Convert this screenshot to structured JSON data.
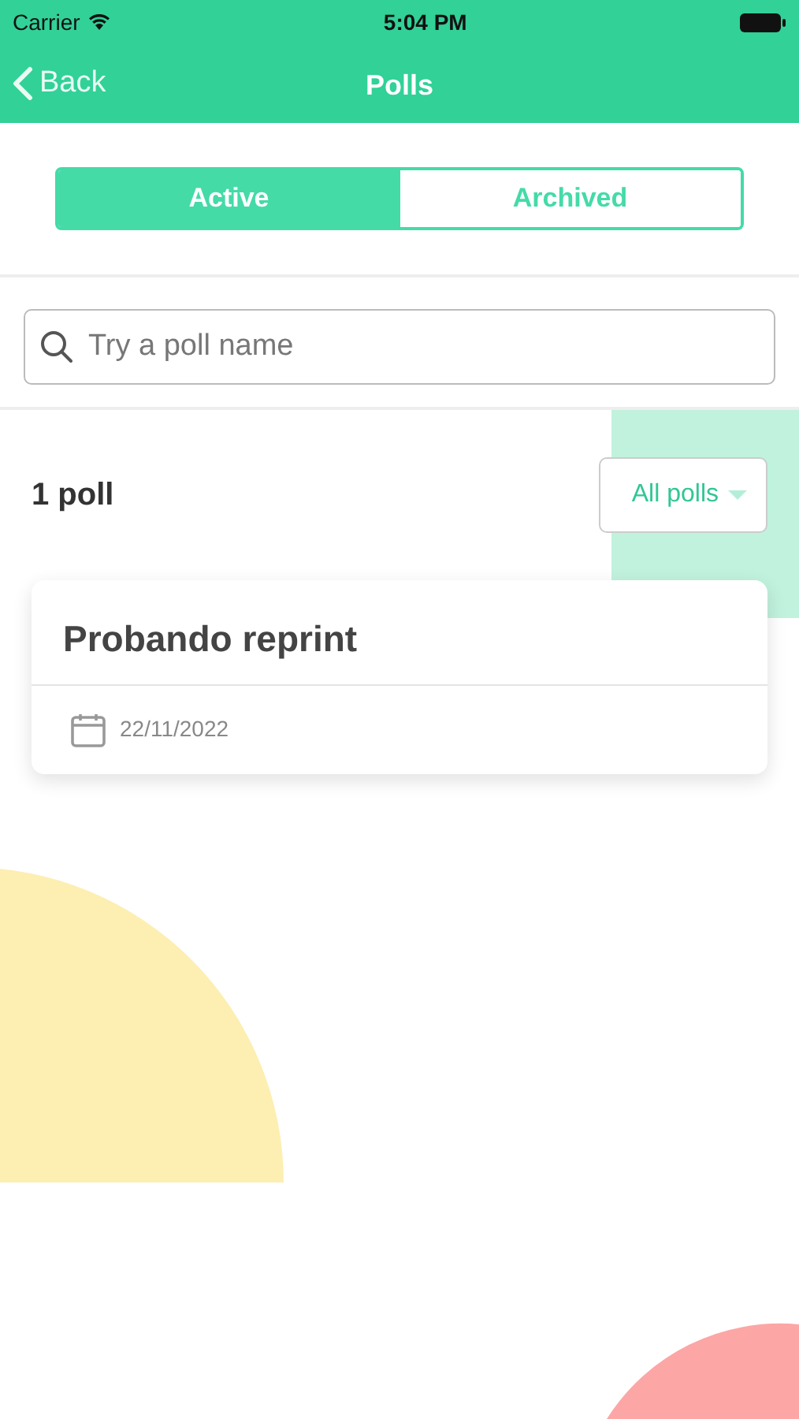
{
  "status_bar": {
    "carrier": "Carrier",
    "time": "5:04 PM"
  },
  "nav": {
    "back": "Back",
    "title": "Polls"
  },
  "tabs": [
    {
      "label": "Active",
      "selected": true
    },
    {
      "label": "Archived",
      "selected": false
    }
  ],
  "search": {
    "placeholder": "Try a poll name"
  },
  "count": "1 poll",
  "filter": {
    "label": "All polls"
  },
  "polls": [
    {
      "title": "Probando reprint",
      "date": "22/11/2022"
    }
  ]
}
